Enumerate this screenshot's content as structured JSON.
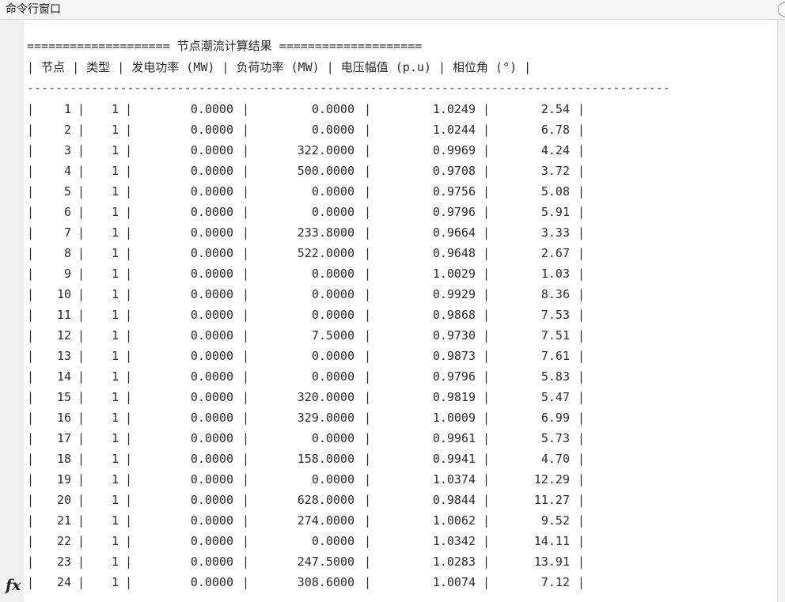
{
  "window": {
    "title": "命令行窗口"
  },
  "output": {
    "banner": "==================== 节点潮流计算结果 ====================",
    "header": "| 节点 | 类型 | 发电功率 (MW) | 负荷功率 (MW) | 电压幅值 (p.u) | 相位角 (°) |",
    "separator": "------------------------------------------------------------------------------------------",
    "rows": [
      [
        "1",
        "1",
        "0.0000",
        "0.0000",
        "1.0249",
        "2.54"
      ],
      [
        "2",
        "1",
        "0.0000",
        "0.0000",
        "1.0244",
        "6.78"
      ],
      [
        "3",
        "1",
        "0.0000",
        "322.0000",
        "0.9969",
        "4.24"
      ],
      [
        "4",
        "1",
        "0.0000",
        "500.0000",
        "0.9708",
        "3.72"
      ],
      [
        "5",
        "1",
        "0.0000",
        "0.0000",
        "0.9756",
        "5.08"
      ],
      [
        "6",
        "1",
        "0.0000",
        "0.0000",
        "0.9796",
        "5.91"
      ],
      [
        "7",
        "1",
        "0.0000",
        "233.8000",
        "0.9664",
        "3.33"
      ],
      [
        "8",
        "1",
        "0.0000",
        "522.0000",
        "0.9648",
        "2.67"
      ],
      [
        "9",
        "1",
        "0.0000",
        "0.0000",
        "1.0029",
        "1.03"
      ],
      [
        "10",
        "1",
        "0.0000",
        "0.0000",
        "0.9929",
        "8.36"
      ],
      [
        "11",
        "1",
        "0.0000",
        "0.0000",
        "0.9868",
        "7.53"
      ],
      [
        "12",
        "1",
        "0.0000",
        "7.5000",
        "0.9730",
        "7.51"
      ],
      [
        "13",
        "1",
        "0.0000",
        "0.0000",
        "0.9873",
        "7.61"
      ],
      [
        "14",
        "1",
        "0.0000",
        "0.0000",
        "0.9796",
        "5.83"
      ],
      [
        "15",
        "1",
        "0.0000",
        "320.0000",
        "0.9819",
        "5.47"
      ],
      [
        "16",
        "1",
        "0.0000",
        "329.0000",
        "1.0009",
        "6.99"
      ],
      [
        "17",
        "1",
        "0.0000",
        "0.0000",
        "0.9961",
        "5.73"
      ],
      [
        "18",
        "1",
        "0.0000",
        "158.0000",
        "0.9941",
        "4.70"
      ],
      [
        "19",
        "1",
        "0.0000",
        "0.0000",
        "1.0374",
        "12.29"
      ],
      [
        "20",
        "1",
        "0.0000",
        "628.0000",
        "0.9844",
        "11.27"
      ],
      [
        "21",
        "1",
        "0.0000",
        "274.0000",
        "1.0062",
        "9.52"
      ],
      [
        "22",
        "1",
        "0.0000",
        "0.0000",
        "1.0342",
        "14.11"
      ],
      [
        "23",
        "1",
        "0.0000",
        "247.5000",
        "1.0283",
        "13.91"
      ],
      [
        "24",
        "1",
        "0.0000",
        "308.6000",
        "1.0074",
        "7.12"
      ]
    ]
  },
  "prompt": {
    "fx_label": "fx"
  }
}
